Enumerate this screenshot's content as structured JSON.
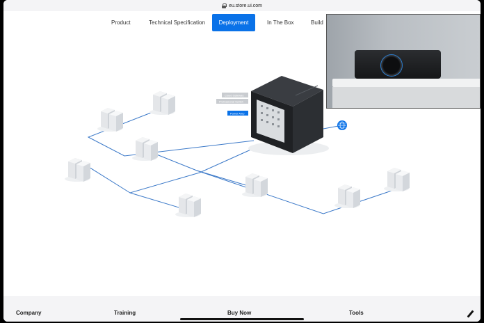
{
  "browser": {
    "url": "eu.store.ui.com"
  },
  "nav": {
    "items": [
      {
        "label": "Product"
      },
      {
        "label": "Technical Specification"
      },
      {
        "label": "Deployment",
        "active": true
      },
      {
        "label": "In The Box"
      },
      {
        "label": "Build"
      }
    ]
  },
  "diagram": {
    "rack_labels": [
      "Cloud Gateway",
      "Professional Switch",
      "Power Amp"
    ],
    "link_color": "#3a78c8",
    "accent": "#0a72e8"
  },
  "footer": {
    "items": [
      "Company",
      "Training",
      "Buy Now",
      "Tools"
    ]
  }
}
